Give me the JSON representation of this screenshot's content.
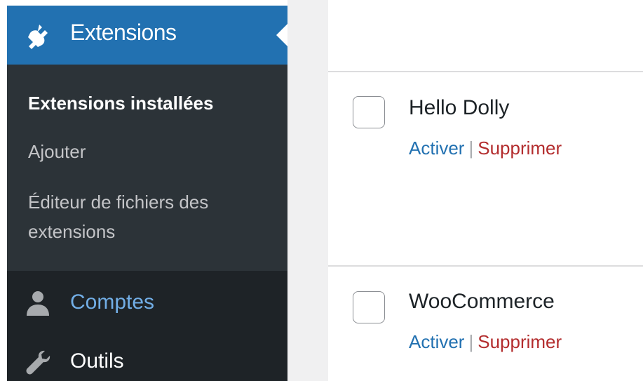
{
  "sidebar": {
    "current_menu": {
      "label": "Extensions",
      "icon": "plug-icon"
    },
    "submenu": [
      {
        "label": "Extensions installées",
        "active": true
      },
      {
        "label": "Ajouter",
        "active": false
      },
      {
        "label": "Éditeur de fichiers des extensions",
        "active": false
      }
    ],
    "menu_items": [
      {
        "label": "Comptes",
        "icon": "user-icon"
      },
      {
        "label": "Outils",
        "icon": "wrench-icon"
      }
    ]
  },
  "plugins": [
    {
      "name": "Hello Dolly",
      "activate_label": "Activer",
      "separator": "|",
      "delete_label": "Supprimer"
    },
    {
      "name": "WooCommerce",
      "activate_label": "Activer",
      "separator": "|",
      "delete_label": "Supprimer"
    }
  ],
  "colors": {
    "sidebar_bg": "#1e2327",
    "submenu_bg": "#2c3338",
    "accent": "#2271b1",
    "link_blue": "#2271b1",
    "delete_red": "#b32d2e",
    "hover_blue": "#72aee6"
  }
}
